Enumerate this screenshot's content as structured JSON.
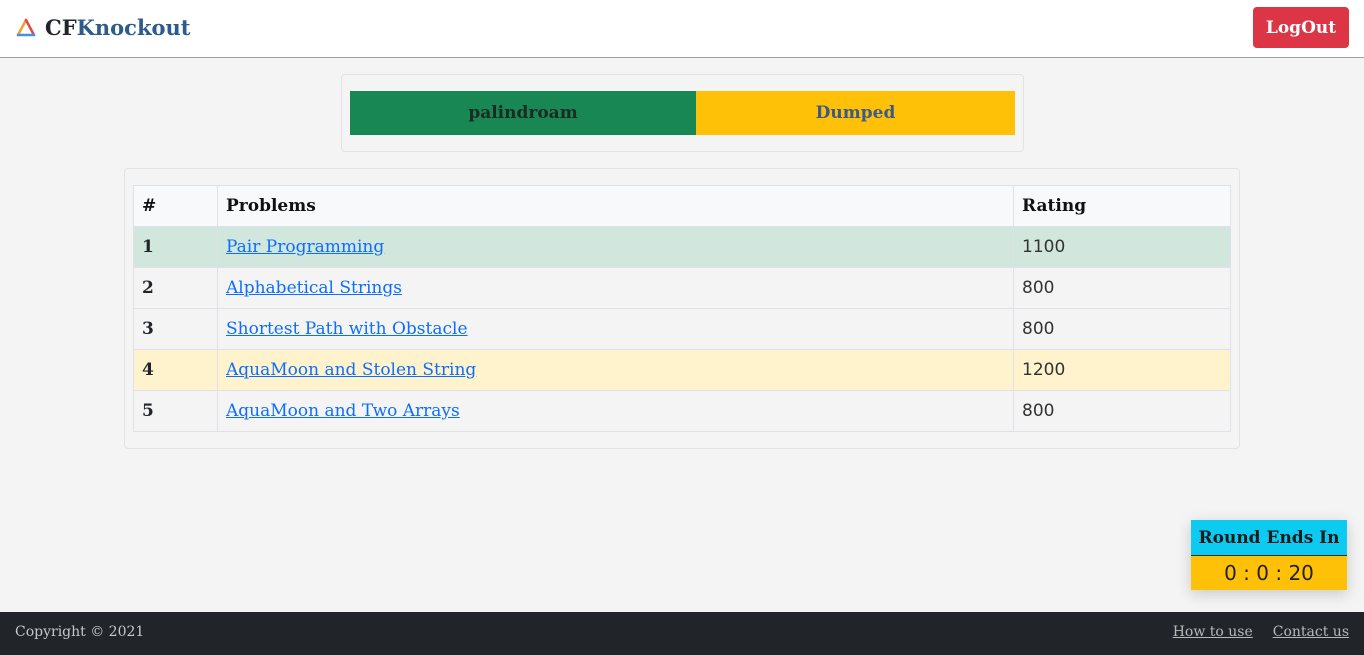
{
  "navbar": {
    "brand_cf": "CF",
    "brand_knockout": "Knockout",
    "logout_label": "LogOut",
    "logo_icon": "tricolor-triangle-logo-icon"
  },
  "match": {
    "left_player": "palindroam",
    "right_player": "Dumped",
    "left_color": "#198754",
    "right_color": "#ffc107"
  },
  "problems": {
    "headers": [
      "#",
      "Problems",
      "Rating"
    ],
    "rows": [
      {
        "num": "1",
        "name": "Pair Programming",
        "rating": "1100",
        "status": "solved"
      },
      {
        "num": "2",
        "name": "Alphabetical Strings",
        "rating": "800",
        "status": "none"
      },
      {
        "num": "3",
        "name": "Shortest Path with Obstacle",
        "rating": "800",
        "status": "none"
      },
      {
        "num": "4",
        "name": "AquaMoon and Stolen String",
        "rating": "1200",
        "status": "pending"
      },
      {
        "num": "5",
        "name": "AquaMoon and Two Arrays",
        "rating": "800",
        "status": "none"
      }
    ]
  },
  "timer": {
    "title": "Round Ends In",
    "value": "0 : 0 : 20"
  },
  "footer": {
    "copyright": "Copyright © 2021",
    "links": [
      "How to use",
      "Contact us"
    ]
  },
  "colors": {
    "solved_row": "#d1e7dd",
    "pending_row": "#fff3cd",
    "logout": "#dc3545",
    "timer_title": "#0dcaf0",
    "timer_value": "#ffc107"
  }
}
